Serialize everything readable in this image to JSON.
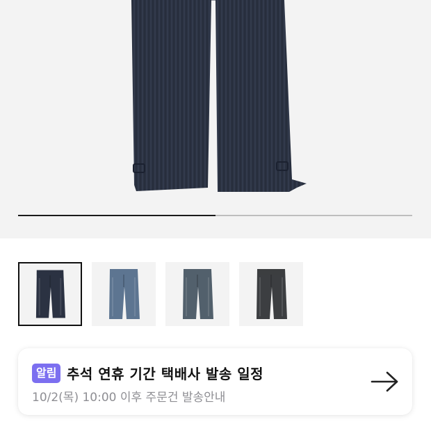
{
  "product": {
    "image_index": 1,
    "image_count": 2,
    "progress_fraction": 0.5,
    "thumbnails": [
      {
        "name": "thumbnail-1",
        "color": "#2b3242",
        "selected": true
      },
      {
        "name": "thumbnail-2",
        "color": "#5d7591",
        "selected": false
      },
      {
        "name": "thumbnail-3",
        "color": "#52606c",
        "selected": false
      },
      {
        "name": "thumbnail-4",
        "color": "#3c3e41",
        "selected": false
      }
    ]
  },
  "notice": {
    "badge": "알림",
    "title": "추석 연휴 기간 택배사 발송 일정",
    "subtitle": "10/2(목) 10:00 이후 주문건 발송안내",
    "arrow_icon": "arrow-right-icon"
  },
  "colors": {
    "badge_bg": "#7c6ff0",
    "hero_bg": "#f3f3f3",
    "denim_main": "#2b3242",
    "progress_fill": "#1a1a1a",
    "progress_track": "#bdbdbd"
  }
}
